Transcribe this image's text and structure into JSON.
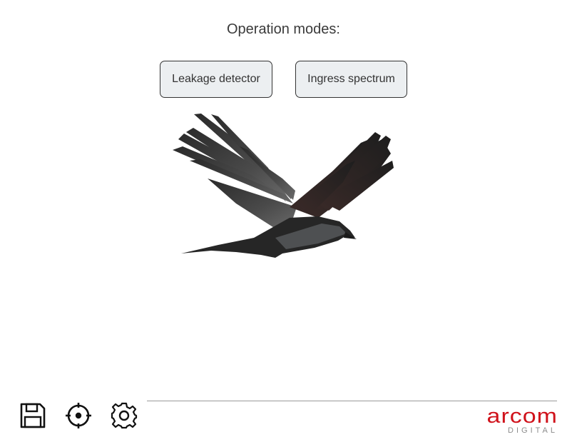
{
  "header": {
    "title": "Operation modes:"
  },
  "modes": {
    "leakage_label": "Leakage detector",
    "ingress_label": "Ingress spectrum"
  },
  "toolbar": {
    "save_icon": "floppy-disk-icon",
    "locate_icon": "crosshair-icon",
    "settings_icon": "gear-icon"
  },
  "brand": {
    "name": "arcom",
    "tagline": "DIGITAL",
    "color": "#d0121b",
    "tagline_color": "#8c8c8c"
  }
}
